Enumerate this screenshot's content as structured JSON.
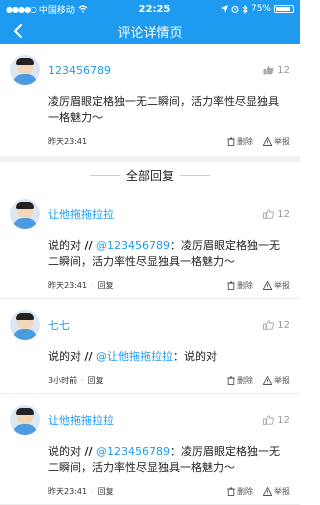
{
  "status_bar": {
    "carrier": "中国移动",
    "time": "22:25",
    "battery": "75%",
    "battery_level": 0.75
  },
  "nav": {
    "title": "评论详情页"
  },
  "main_comment": {
    "username": "123456789",
    "likes": "12",
    "text": "凌厉眉眼定格独一无二瞬间，活力率性尽显独具一格魅力～",
    "time": "昨天23:41",
    "delete_label": "删除",
    "report_label": "举报"
  },
  "replies_section": {
    "title": "全部回复"
  },
  "replies": [
    {
      "username": "让他拖拖拉拉",
      "likes": "12",
      "prefix": "说的对",
      "separator": "//",
      "mention": "@123456789",
      "quoted": "：凌厉眉眼定格独一无二瞬间，活力率性尽显独具一格魅力～",
      "time": "昨天23:41",
      "reply_label": "回复",
      "delete_label": "删除",
      "report_label": "举报"
    },
    {
      "username": "七七",
      "likes": "12",
      "prefix": "说的对",
      "separator": "//",
      "mention": "@让他拖拖拉拉",
      "quoted": "：说的对",
      "time": "3小时前",
      "reply_label": "回复",
      "delete_label": "删除",
      "report_label": "举报"
    },
    {
      "username": "让他拖拖拉拉",
      "likes": "12",
      "prefix": "说的对",
      "separator": "//",
      "mention": "@123456789",
      "quoted": "：凌厉眉眼定格独一无二瞬间，活力率性尽显独具一格魅力～",
      "time": "昨天23:41",
      "reply_label": "回复",
      "delete_label": "删除",
      "report_label": "举报"
    }
  ],
  "colors": {
    "accent": "#1e9bf0",
    "text": "#222222",
    "muted": "#999999"
  }
}
